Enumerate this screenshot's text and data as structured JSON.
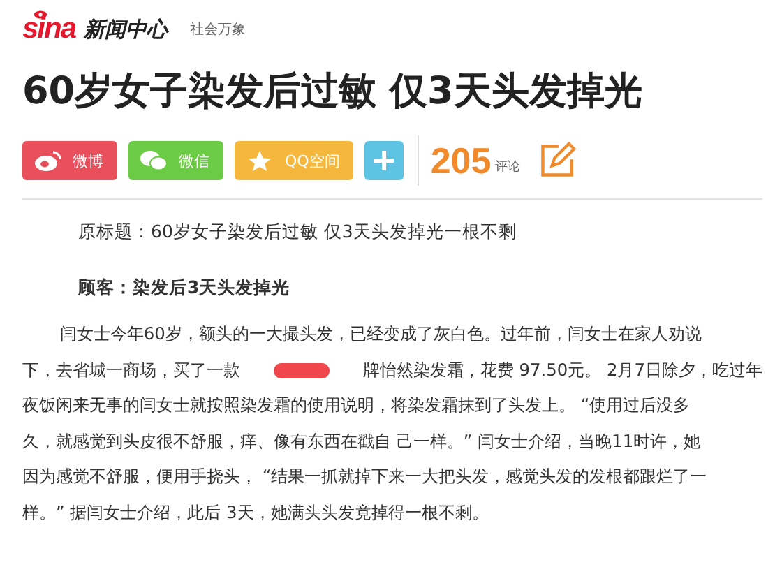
{
  "header": {
    "logo_text": "sina",
    "section": "新闻中心",
    "channel": "社会万象"
  },
  "headline": "60岁女子染发后过敏 仅3天头发掉光",
  "share_buttons": [
    {
      "kind": "weibo",
      "label": "微博",
      "color": "#ea4f5c"
    },
    {
      "kind": "wechat",
      "label": "微信",
      "color": "#6ccb45"
    },
    {
      "kind": "qzone",
      "label": "QQ空间",
      "color": "#f6b83c"
    },
    {
      "kind": "more",
      "color": "#5ec3e3"
    }
  ],
  "comments": {
    "count": "205",
    "label": "评论"
  },
  "article": {
    "original_title": "原标题：60岁女子染发后过敏 仅3天头发掉光一根不剩",
    "subheading": "顾客：染发后3天头发掉光",
    "paragraph_lines": [
      {
        "segments": [
          {
            "kind": "text",
            "text": "闫女士今年60岁，额头的一大撮头发，已经变成了灰白色。过年前，闫女士在家人劝说"
          }
        ]
      },
      {
        "segments": [
          {
            "kind": "text",
            "text": "下，去省城一商场，买了一款"
          },
          {
            "kind": "redaction"
          },
          {
            "kind": "text",
            "text": "牌怡然染发霜，花费 97.50元。 2月7日除夕，吃过年"
          }
        ]
      },
      {
        "segments": [
          {
            "kind": "text",
            "text": "夜饭闲来无事的闫女士就按照染发霜的使用说明，将染发霜抹到了头发上。 “使用过后没多"
          }
        ]
      },
      {
        "segments": [
          {
            "kind": "text",
            "text": "久，就感觉到头皮很不舒服，痒、像有东西在戳自 己一样。” 闫女士介绍，当晚11时许，她"
          }
        ]
      },
      {
        "segments": [
          {
            "kind": "text",
            "text": "因为感觉不舒服，便用手挠头， “结果一抓就掉下来一大把头发，感觉头发的发根都跟烂了一"
          }
        ]
      },
      {
        "segments": [
          {
            "kind": "text",
            "text": "样。” 据闫女士介绍，此后 3天，她满头头发竟掉得一根不剩。"
          }
        ]
      }
    ]
  }
}
